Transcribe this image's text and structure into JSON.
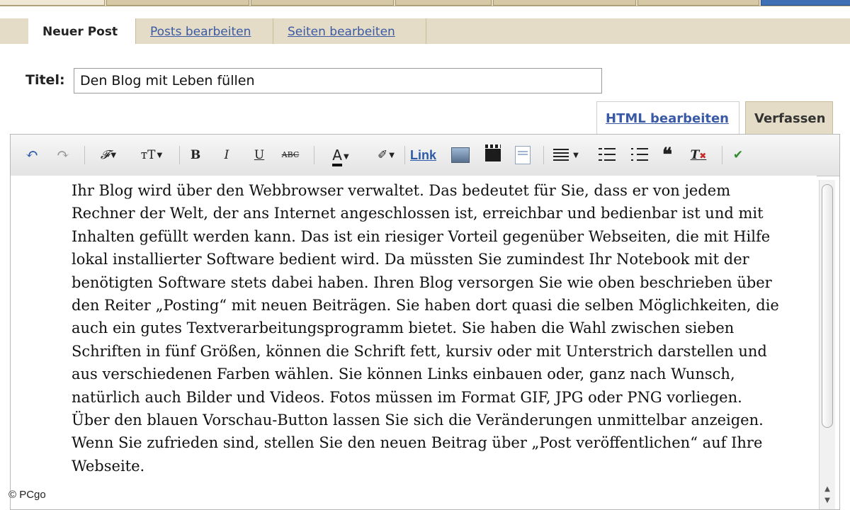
{
  "subtabs": {
    "new_post": "Neuer Post",
    "edit_posts": "Posts bearbeiten",
    "edit_pages": "Seiten bearbeiten"
  },
  "form": {
    "title_label": "Titel:",
    "title_value": "Den Blog mit Leben füllen"
  },
  "mode_tabs": {
    "html": "HTML bearbeiten",
    "compose": "Verfassen"
  },
  "toolbar": {
    "undo": "↶",
    "redo": "↷",
    "font": "𝓕",
    "font_size": "тT",
    "bold": "B",
    "italic": "I",
    "underline": "U",
    "strikethrough": "ABC",
    "text_color": "A",
    "highlight": "✐",
    "link": "Link",
    "quote": "❝",
    "clear_format": "T",
    "spellcheck": "✔"
  },
  "body_text": "Ihr Blog wird über den Webbrowser verwaltet. Das bedeutet für Sie, dass er von jedem Rechner der Welt, der ans Internet angeschlossen ist, erreichbar und bedienbar ist und mit Inhalten gefüllt werden kann. Das ist ein riesiger Vorteil gegenüber Webseiten, die mit Hilfe lokal installierter Software bedient wird. Da müssten Sie zumindest Ihr Notebook mit der benötigten Software stets dabei haben. Ihren Blog versorgen Sie wie oben beschrieben über den Reiter „Posting“ mit neuen Beiträgen. Sie haben dort quasi die selben Möglichkeiten, die auch ein gutes Textverarbeitungsprogramm bietet. Sie haben die Wahl zwischen sieben Schriften in fünf Größen, können die Schrift fett, kursiv oder mit Unterstrich darstellen und aus verschiedenen Farben wählen. Sie können Links einbauen oder, ganz nach Wunsch, natürlich auch Bilder und Videos. Fotos müssen im Format GIF, JPG oder PNG vorliegen. Über den blauen Vorschau-Button lassen Sie sich die Veränderungen unmittelbar anzeigen. Wenn Sie zufrieden sind, stellen Sie den neuen Beitrag über „Post veröffentlichen“ auf Ihre Webseite.",
  "watermark": "© PCgo",
  "colors": {
    "tab_bg": "#e4dcc6",
    "link_blue": "#3b5aa6"
  }
}
